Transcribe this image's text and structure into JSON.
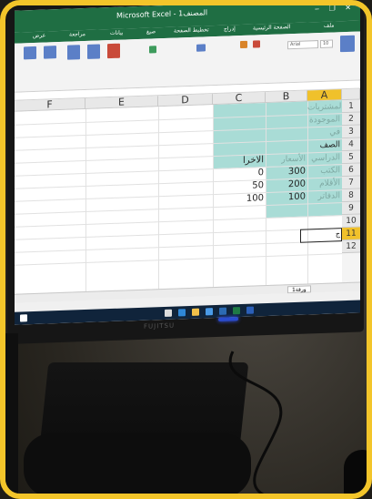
{
  "window": {
    "title": "Microsoft Excel - المصنف1",
    "controls": "‒ ❐ ✕"
  },
  "ribbon_tabs": [
    "ملف",
    "الصفحة الرئيسية",
    "إدراج",
    "تخطيط الصفحة",
    "صيغ",
    "بيانات",
    "مراجعة",
    "عرض"
  ],
  "ribbon": {
    "font_name": "Arial",
    "font_size": "10"
  },
  "columns": [
    "F",
    "E",
    "D",
    "C",
    "B",
    "A"
  ],
  "rows": [
    "1",
    "2",
    "3",
    "4",
    "5",
    "6",
    "7",
    "8",
    "9",
    "10",
    "11",
    "12"
  ],
  "cells": {
    "a1": "المشتريات",
    "a2": "الموجودة",
    "a3": "في",
    "a4": "الصف",
    "a5": "الدراسي",
    "a6": "الكتب",
    "a7": "الأقلام",
    "a8": "الدفاتر",
    "b5": "الأسعار",
    "b6": "300",
    "b7": "200",
    "b8": "100",
    "c5": "الاخرا",
    "c6": "0",
    "c7": "50",
    "c8": "100",
    "b11": "ج"
  },
  "sheet_tabs": [
    "ورقة1"
  ],
  "colors": {
    "excel_green": "#1f6e43",
    "teal_fill": "#a9dcd6",
    "selected_header": "#f0c12b",
    "frame": "#f3c52a",
    "power_led": "#2a4ccf"
  },
  "icons": [
    "start-icon",
    "search-icon",
    "edge-icon",
    "folder-icon",
    "store-icon",
    "mail-icon",
    "excel-icon",
    "word-icon"
  ],
  "monitor_brand": "FUJITSU"
}
